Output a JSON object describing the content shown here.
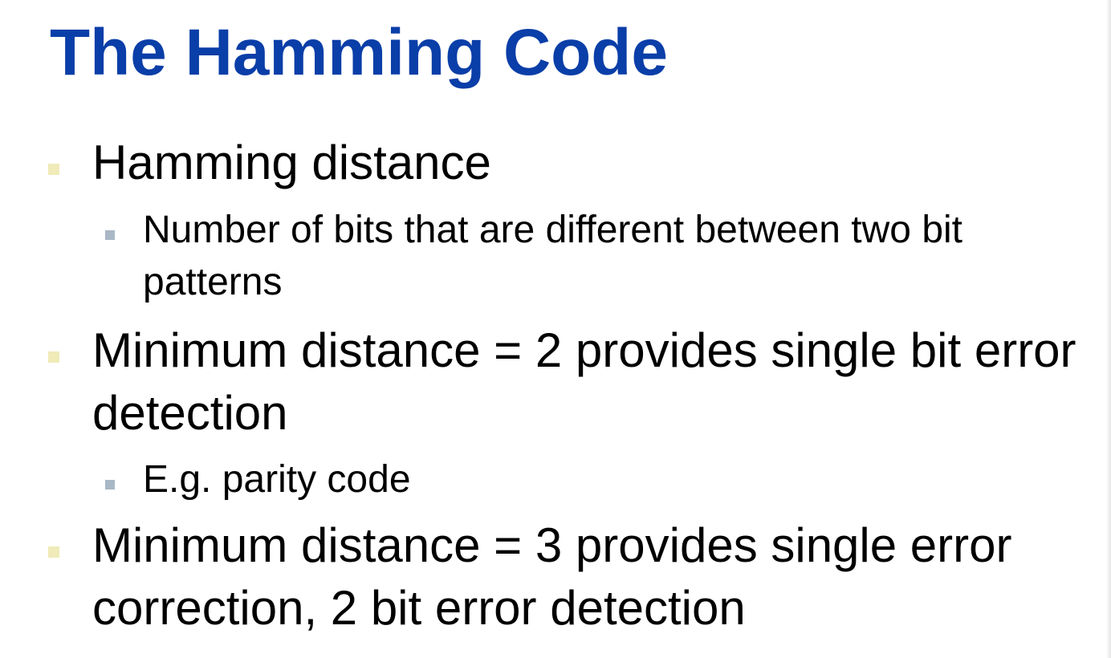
{
  "slide": {
    "title": "The Hamming Code",
    "bullets": [
      {
        "text": "Hamming distance",
        "sub": [
          "Number of bits that are different between two bit patterns"
        ]
      },
      {
        "text": "Minimum distance = 2 provides single bit error detection",
        "sub": [
          "E.g. parity code"
        ]
      },
      {
        "text": "Minimum distance = 3 provides single error correction, 2 bit error detection",
        "sub": []
      }
    ]
  },
  "colors": {
    "title": "#0a3ea8",
    "bullet_marker": "#f0ebb8",
    "sub_bullet_marker": "#a9b8c6"
  }
}
